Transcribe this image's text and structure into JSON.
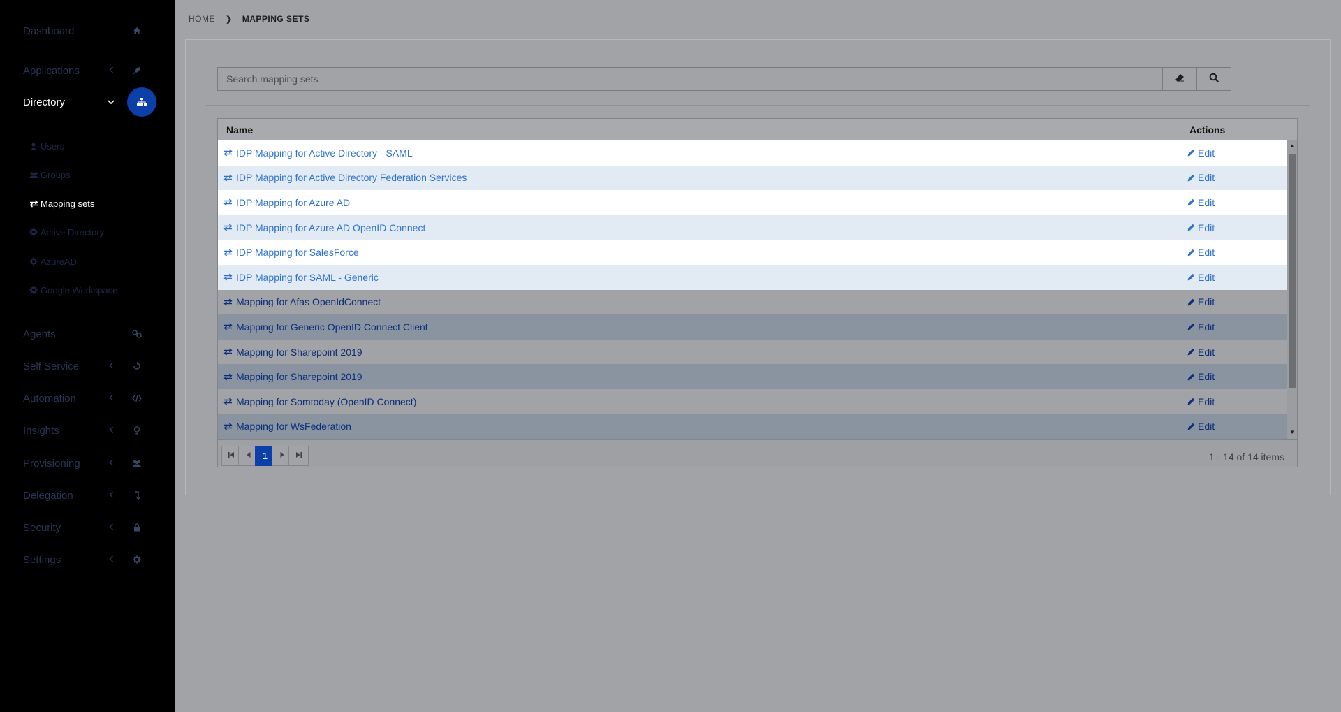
{
  "sidebar": {
    "items": [
      {
        "label": "Dashboard",
        "icon": "home-icon",
        "chevron": false
      },
      {
        "label": "Applications",
        "icon": "rocket-icon",
        "chevron": true
      },
      {
        "label": "Directory",
        "icon": "sitemap-icon",
        "chevron": true,
        "active": true
      },
      {
        "label": "Agents",
        "icon": "agents-icon",
        "chevron": false
      },
      {
        "label": "Self Service",
        "icon": "self-service-icon",
        "chevron": true
      },
      {
        "label": "Automation",
        "icon": "code-icon",
        "chevron": true
      },
      {
        "label": "Insights",
        "icon": "lightbulb-icon",
        "chevron": true
      },
      {
        "label": "Provisioning",
        "icon": "users-icon",
        "chevron": true
      },
      {
        "label": "Delegation",
        "icon": "delegation-icon",
        "chevron": true
      },
      {
        "label": "Security",
        "icon": "lock-icon",
        "chevron": true
      },
      {
        "label": "Settings",
        "icon": "gear-icon",
        "chevron": true
      }
    ],
    "directory_sub": [
      {
        "label": "Users",
        "icon": "user-icon"
      },
      {
        "label": "Groups",
        "icon": "group-icon"
      },
      {
        "label": "Mapping sets",
        "icon": "swap-icon",
        "active": true
      },
      {
        "label": "Active Directory",
        "icon": "gear-icon"
      },
      {
        "label": "AzureAD",
        "icon": "gear-icon"
      },
      {
        "label": "Google Workspace",
        "icon": "gear-icon"
      }
    ]
  },
  "breadcrumb": {
    "home": "HOME",
    "current": "MAPPING SETS"
  },
  "search": {
    "placeholder": "Search mapping sets",
    "value": ""
  },
  "grid": {
    "columns": {
      "name": "Name",
      "actions": "Actions"
    },
    "action_label": "Edit",
    "rows": [
      {
        "name": "IDP Mapping for Active Directory - SAML",
        "highlighted": true
      },
      {
        "name": "IDP Mapping for Active Directory Federation Services",
        "highlighted": true
      },
      {
        "name": "IDP Mapping for Azure AD",
        "highlighted": true
      },
      {
        "name": "IDP Mapping for Azure AD OpenID Connect",
        "highlighted": true
      },
      {
        "name": "IDP Mapping for SalesForce",
        "highlighted": true
      },
      {
        "name": "IDP Mapping for SAML - Generic",
        "highlighted": true
      },
      {
        "name": "Mapping for Afas OpenIdConnect",
        "highlighted": false
      },
      {
        "name": "Mapping for Generic OpenID Connect Client",
        "highlighted": false
      },
      {
        "name": "Mapping for Sharepoint 2019",
        "highlighted": false
      },
      {
        "name": "Mapping for Sharepoint 2019",
        "highlighted": false
      },
      {
        "name": "Mapping for Somtoday (OpenID Connect)",
        "highlighted": false
      },
      {
        "name": "Mapping for WsFederation",
        "highlighted": false
      }
    ]
  },
  "pager": {
    "current_page": "1",
    "info": "1 - 14 of 14 items"
  },
  "colors": {
    "sidebar_bg": "#000000",
    "active_accent": "#0c3fa8",
    "link_highlight": "#2f73cf",
    "link_dim": "#0b2f7a"
  }
}
